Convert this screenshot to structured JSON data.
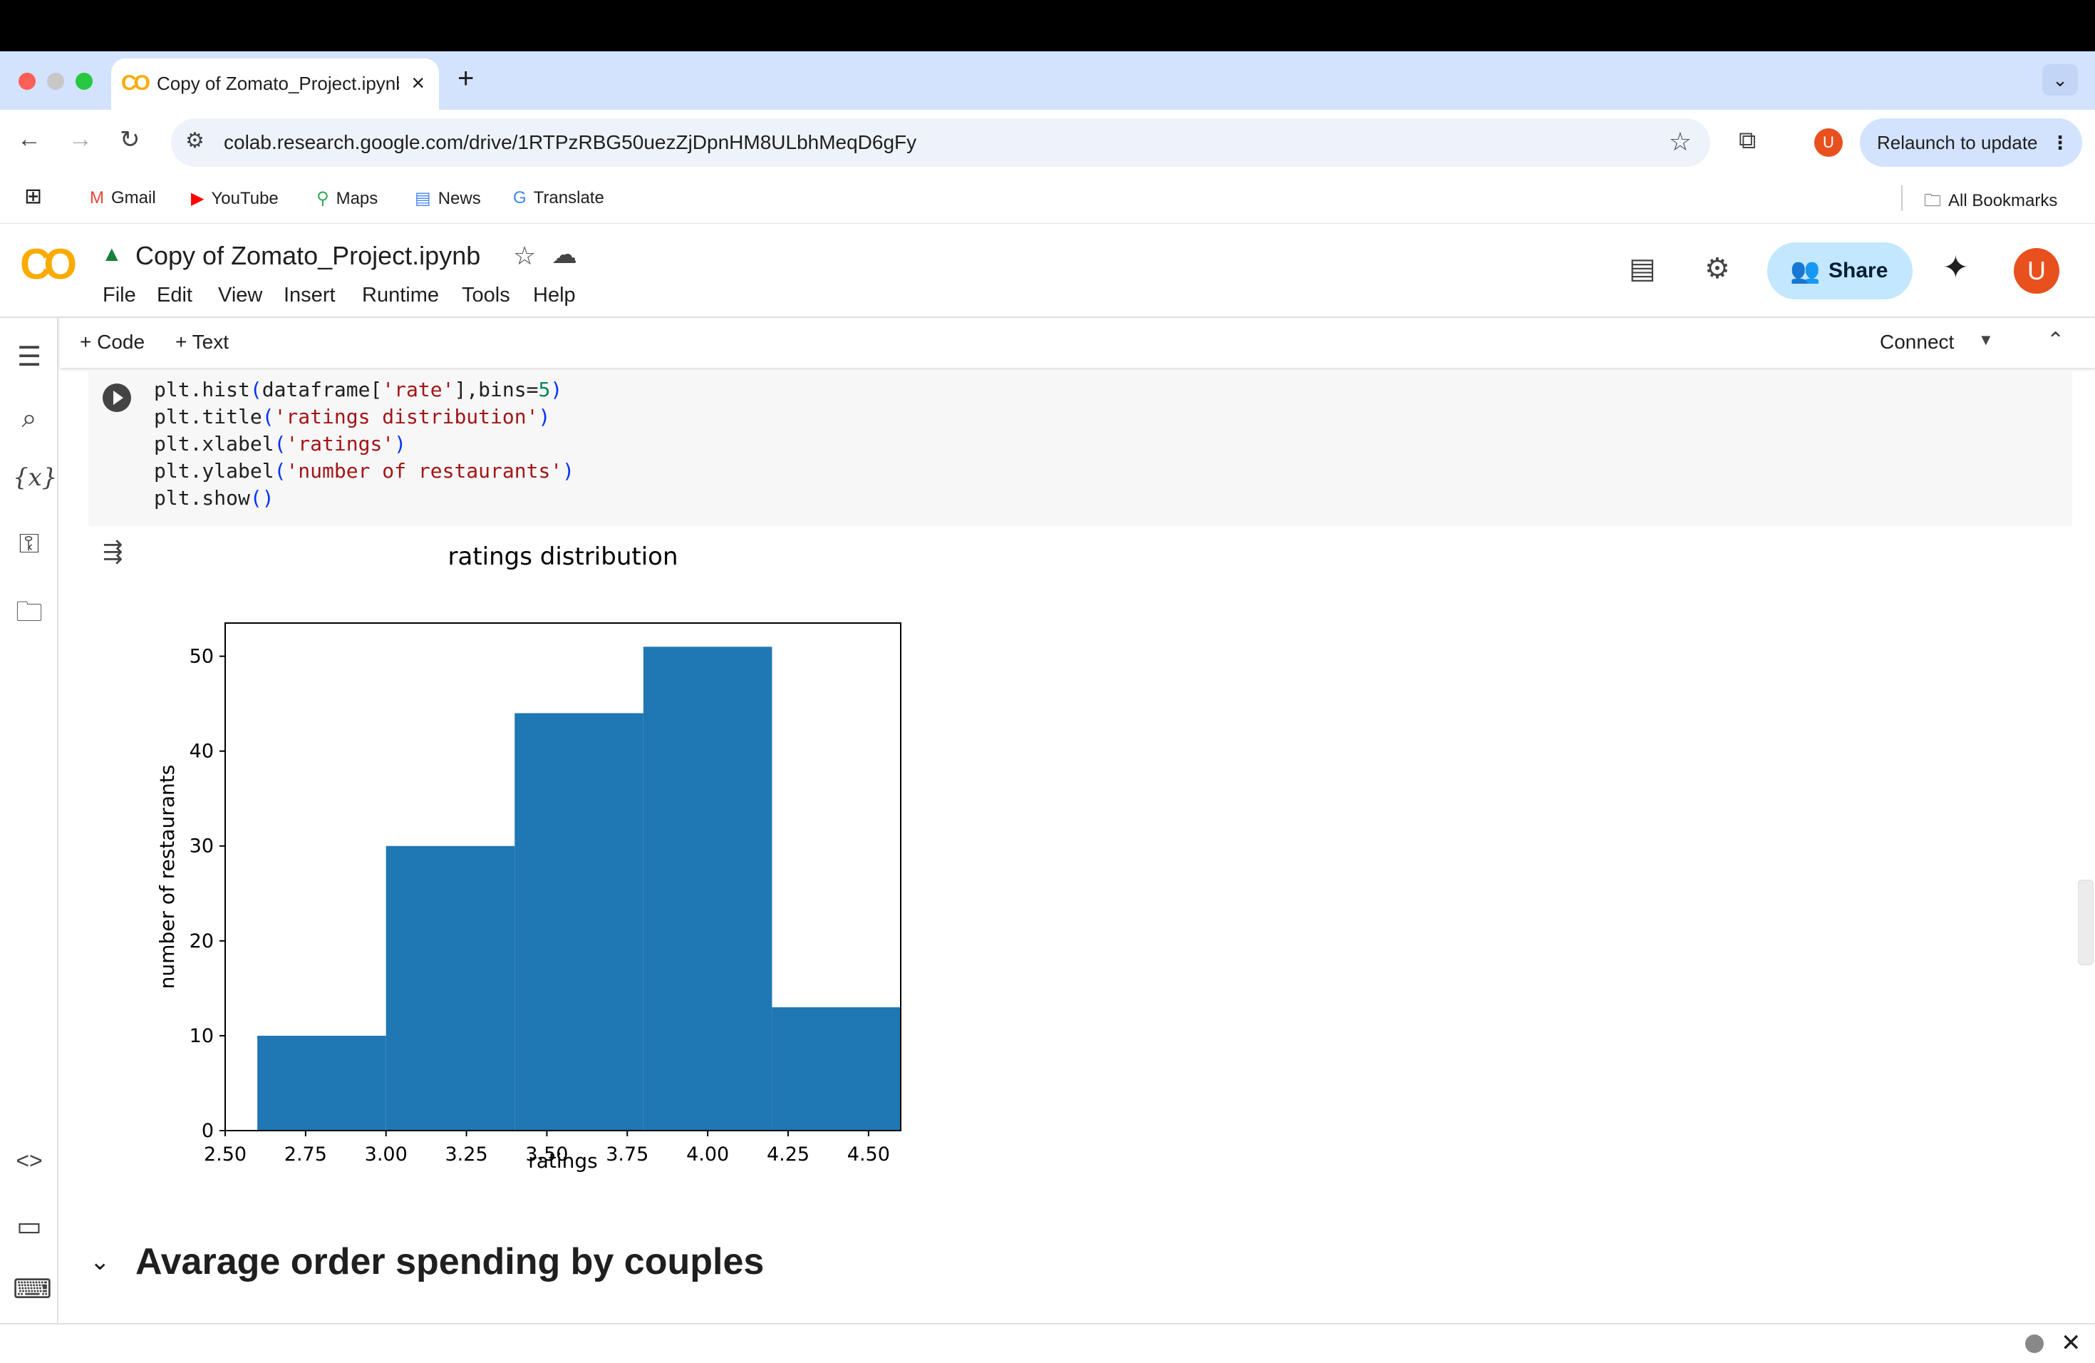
{
  "browser": {
    "tab_title": "Copy of Zomato_Project.ipynb",
    "url": "colab.research.google.com/drive/1RTPzRBG50uezZjDpnHM8ULbhMeqD6gFy",
    "relaunch_label": "Relaunch to update",
    "profile_initial": "U",
    "bookmarks": [
      "Gmail",
      "YouTube",
      "Maps",
      "News",
      "Translate"
    ],
    "all_bookmarks": "All Bookmarks"
  },
  "colab": {
    "notebook_title": "Copy of Zomato_Project.ipynb",
    "menu": [
      "File",
      "Edit",
      "View",
      "Insert",
      "Runtime",
      "Tools",
      "Help"
    ],
    "share_label": "Share",
    "user_initial": "U",
    "add_code": "+ Code",
    "add_text": "+ Text",
    "connect_label": "Connect",
    "section_heading": "Avarage order spending by couples"
  },
  "code_lines": [
    "plt.hist(dataframe['rate'],bins=5)",
    "plt.title('ratings distribution')",
    "plt.xlabel('ratings')",
    "plt.ylabel('number of restaurants')",
    "plt.show()"
  ],
  "chart_data": {
    "type": "bar",
    "title": "ratings distribution",
    "xlabel": "ratings",
    "ylabel": "number of restaurants",
    "bins": [
      {
        "x0": 2.6,
        "x1": 3.0,
        "value": 10
      },
      {
        "x0": 3.0,
        "x1": 3.4,
        "value": 30
      },
      {
        "x0": 3.4,
        "x1": 3.8,
        "value": 44
      },
      {
        "x0": 3.8,
        "x1": 4.2,
        "value": 51
      },
      {
        "x0": 4.2,
        "x1": 4.6,
        "value": 13
      }
    ],
    "xlim": [
      2.5,
      4.6
    ],
    "ylim": [
      0,
      53.5
    ],
    "xticks": [
      "2.50",
      "2.75",
      "3.00",
      "3.25",
      "3.50",
      "3.75",
      "4.00",
      "4.25",
      "4.50"
    ],
    "xtick_values": [
      2.5,
      2.75,
      3.0,
      3.25,
      3.5,
      3.75,
      4.0,
      4.25,
      4.5
    ],
    "yticks": [
      "0",
      "10",
      "20",
      "30",
      "40",
      "50"
    ],
    "ytick_values": [
      0,
      10,
      20,
      30,
      40,
      50
    ],
    "bar_color": "#1f77b4"
  }
}
